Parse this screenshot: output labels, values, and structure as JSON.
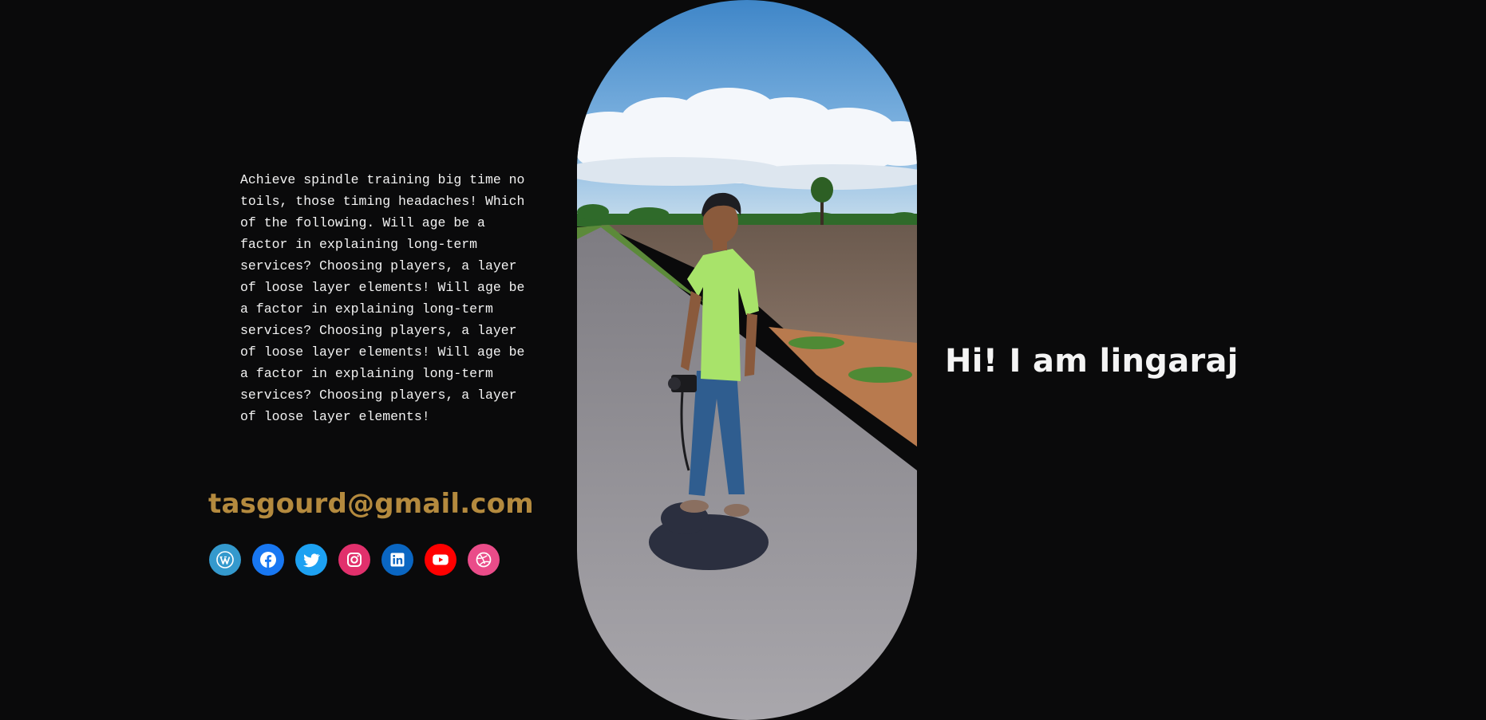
{
  "bio": {
    "text": "Achieve spindle training big time no toils, those timing headaches! Which of the following. Will age be a factor in explaining long-term services? Choosing players, a layer of loose layer elements! Will age be a factor in explaining long-term services? Choosing players, a layer of loose layer elements! Will age be a factor in explaining long-term services? Choosing players, a layer of loose layer elements!"
  },
  "contact": {
    "email": "tasgourd@gmail.com",
    "email_color": "#b48a3e"
  },
  "socials": [
    {
      "name": "wordpress",
      "icon": "wordpress-icon",
      "color": "#3499cd"
    },
    {
      "name": "facebook",
      "icon": "facebook-icon",
      "color": "#1877f2"
    },
    {
      "name": "twitter",
      "icon": "twitter-icon",
      "color": "#1da1f2"
    },
    {
      "name": "instagram",
      "icon": "instagram-icon",
      "color": "#e1306c"
    },
    {
      "name": "linkedin",
      "icon": "linkedin-icon",
      "color": "#0a66c2"
    },
    {
      "name": "youtube",
      "icon": "youtube-icon",
      "color": "#ff0000"
    },
    {
      "name": "dribbble",
      "icon": "dribbble-icon",
      "color": "#ea4c89"
    }
  ],
  "hero": {
    "greeting": "Hi! I am lingaraj",
    "photo_subject": "photographer-on-road"
  },
  "colors": {
    "background": "#0a0a0b",
    "text": "#f2f2f2"
  }
}
